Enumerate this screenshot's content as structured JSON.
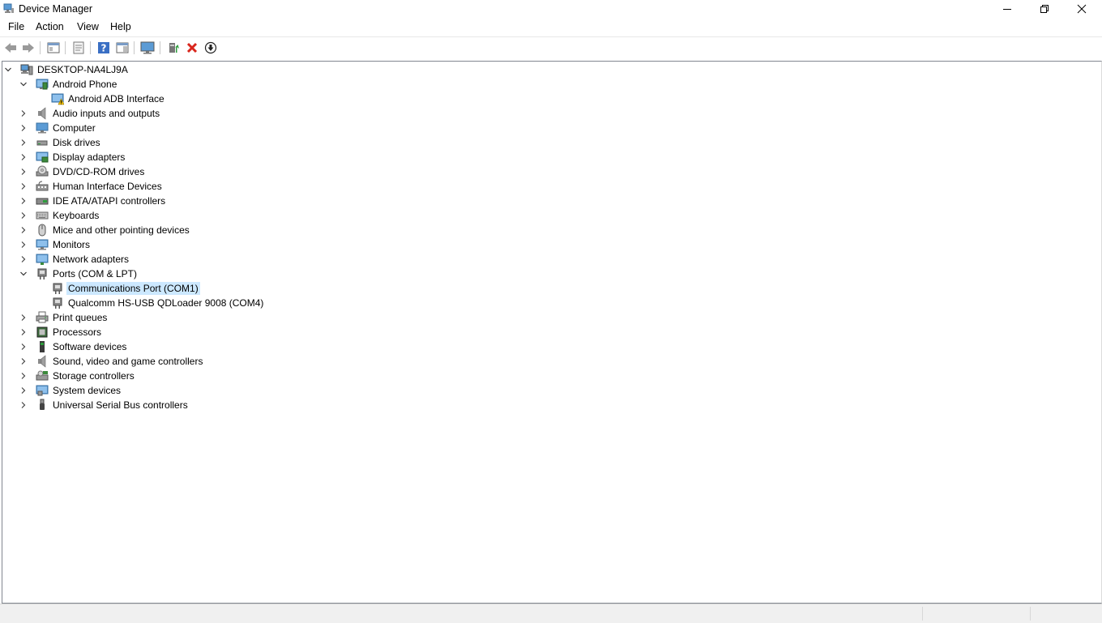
{
  "window": {
    "title": "Device Manager"
  },
  "menu": [
    "File",
    "Action",
    "View",
    "Help"
  ],
  "toolbar": [
    "back-icon",
    "forward-icon",
    "show-hide-console-tree-icon",
    "properties-icon",
    "help-icon",
    "action-pane-icon",
    "monitor-icon",
    "update-driver-icon",
    "uninstall-icon",
    "disable-device-icon"
  ],
  "tree": {
    "root": "DESKTOP-NA4LJ9A",
    "categories": [
      {
        "label": "Android Phone",
        "icon": "phone-icon",
        "expanded": true,
        "children": [
          {
            "label": "Android ADB Interface",
            "icon": "warning-device-icon"
          }
        ]
      },
      {
        "label": "Audio inputs and outputs",
        "icon": "speaker-icon"
      },
      {
        "label": "Computer",
        "icon": "computer-icon"
      },
      {
        "label": "Disk drives",
        "icon": "disk-icon"
      },
      {
        "label": "Display adapters",
        "icon": "display-adapter-icon"
      },
      {
        "label": "DVD/CD-ROM drives",
        "icon": "dvd-icon"
      },
      {
        "label": "Human Interface Devices",
        "icon": "hid-icon"
      },
      {
        "label": "IDE ATA/ATAPI controllers",
        "icon": "ide-icon"
      },
      {
        "label": "Keyboards",
        "icon": "keyboard-icon"
      },
      {
        "label": "Mice and other pointing devices",
        "icon": "mouse-icon"
      },
      {
        "label": "Monitors",
        "icon": "monitor-icon"
      },
      {
        "label": "Network adapters",
        "icon": "network-icon"
      },
      {
        "label": "Ports (COM & LPT)",
        "icon": "port-icon",
        "expanded": true,
        "children": [
          {
            "label": "Communications Port (COM1)",
            "icon": "port-icon",
            "selected": true
          },
          {
            "label": "Qualcomm HS-USB QDLoader 9008 (COM4)",
            "icon": "port-icon"
          }
        ]
      },
      {
        "label": "Print queues",
        "icon": "printer-icon"
      },
      {
        "label": "Processors",
        "icon": "processor-icon"
      },
      {
        "label": "Software devices",
        "icon": "software-device-icon"
      },
      {
        "label": "Sound, video and game controllers",
        "icon": "speaker-icon"
      },
      {
        "label": "Storage controllers",
        "icon": "storage-icon"
      },
      {
        "label": "System devices",
        "icon": "system-icon"
      },
      {
        "label": "Universal Serial Bus controllers",
        "icon": "usb-icon"
      }
    ]
  }
}
